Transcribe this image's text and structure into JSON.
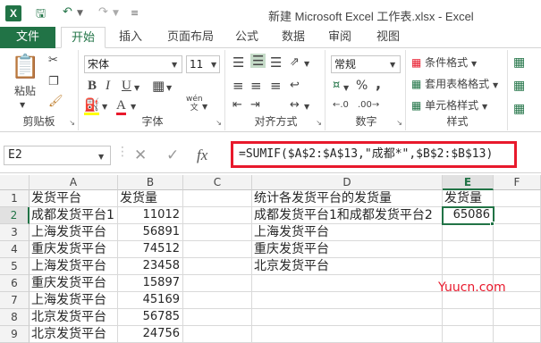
{
  "title": "新建 Microsoft Excel 工作表.xlsx - Excel",
  "app_logo": "X",
  "qat": {
    "save_icon": "save-icon",
    "undo_icon": "undo-icon",
    "redo_icon": "redo-icon"
  },
  "tabs": [
    {
      "label": "文件"
    },
    {
      "label": "开始"
    },
    {
      "label": "插入"
    },
    {
      "label": "页面布局"
    },
    {
      "label": "公式"
    },
    {
      "label": "数据"
    },
    {
      "label": "审阅"
    },
    {
      "label": "视图"
    }
  ],
  "ribbon": {
    "clipboard": {
      "paste_label": "粘贴",
      "group_label": "剪贴板"
    },
    "font": {
      "font_name": "宋体",
      "font_size": "11",
      "group_label": "字体",
      "wen": "wén\n文"
    },
    "alignment": {
      "group_label": "对齐方式"
    },
    "number": {
      "format": "常规",
      "group_label": "数字",
      "percent": "%",
      "comma": ","
    },
    "styles": {
      "conditional": "条件格式",
      "table": "套用表格格式",
      "cell": "单元格样式",
      "group_label": "样式"
    }
  },
  "formula_bar": {
    "name_box": "E2",
    "formula": "=SUMIF($A$2:$A$13,\"成都*\",$B$2:$B$13)",
    "fx": "fx"
  },
  "columns": [
    "A",
    "B",
    "C",
    "D",
    "E",
    "F"
  ],
  "rows": [
    {
      "num": "1",
      "A": "发货平台",
      "B": "发货量",
      "D": "统计各发货平台的发货量",
      "E": "发货量"
    },
    {
      "num": "2",
      "A": "成都发货平台1",
      "B": "11012",
      "D": "成都发货平台1和成都发货平台2",
      "E": "65086"
    },
    {
      "num": "3",
      "A": "上海发货平台",
      "B": "56891",
      "D": "上海发货平台",
      "E": ""
    },
    {
      "num": "4",
      "A": "重庆发货平台",
      "B": "74512",
      "D": "重庆发货平台",
      "E": ""
    },
    {
      "num": "5",
      "A": "上海发货平台",
      "B": "23458",
      "D": "北京发货平台",
      "E": ""
    },
    {
      "num": "6",
      "A": "重庆发货平台",
      "B": "15897",
      "D": "",
      "E": ""
    },
    {
      "num": "7",
      "A": "上海发货平台",
      "B": "45169",
      "D": "",
      "E": ""
    },
    {
      "num": "8",
      "A": "北京发货平台",
      "B": "56785",
      "D": "",
      "E": ""
    },
    {
      "num": "9",
      "A": "北京发货平台",
      "B": "24756",
      "D": "",
      "E": ""
    }
  ],
  "watermark": "Yuucn.com",
  "colors": {
    "accent": "#217346",
    "highlight_border": "#e8192c"
  }
}
